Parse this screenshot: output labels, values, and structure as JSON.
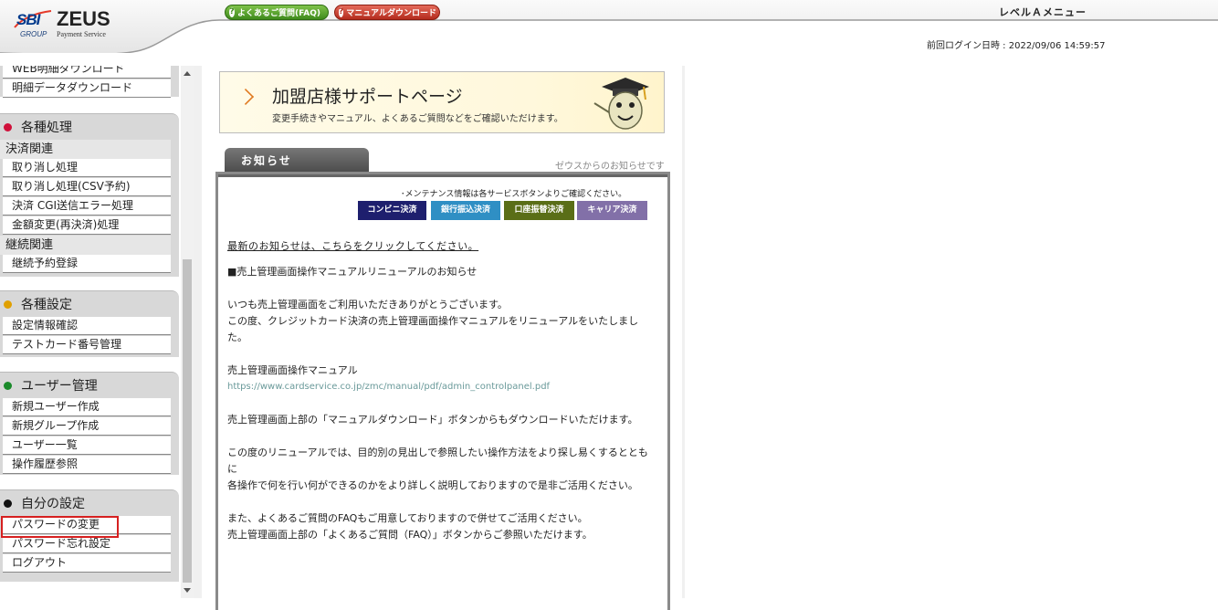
{
  "header": {
    "logo_sbi": "SBI",
    "logo_group": "GROUP",
    "logo_zeus": "ZEUS",
    "logo_payment": "Payment Service",
    "faq_button": "よくあるご質問(FAQ)",
    "manual_button": "マニュアルダウンロード",
    "level_title": "レベルＡメニュー",
    "last_login": "前回ログイン日時 : 2022/09/06 14:59:57"
  },
  "sidebar": {
    "top_items": [
      "WEB明細ダウンロード",
      "明細データダウンロード"
    ],
    "sections": [
      {
        "title": "各種処理",
        "dot_color": "#d0103a",
        "groups": [
          {
            "subhead": "決済関連",
            "items": [
              "取り消し処理",
              "取り消し処理(CSV予約)",
              "決済 CGI送信エラー処理",
              "金額変更(再決済)処理"
            ]
          },
          {
            "subhead": "継続関連",
            "items": [
              "継続予約登録"
            ]
          }
        ]
      },
      {
        "title": "各種設定",
        "dot_color": "#e0a000",
        "items": [
          "設定情報確認",
          "テストカード番号管理"
        ]
      },
      {
        "title": "ユーザー管理",
        "dot_color": "#1a8a2a",
        "items": [
          "新規ユーザー作成",
          "新規グループ作成",
          "ユーザー一覧",
          "操作履歴参照"
        ]
      },
      {
        "title": "自分の設定",
        "dot_color": "#111111",
        "items": [
          "パスワードの変更",
          "パスワード忘れ設定",
          "ログアウト"
        ]
      }
    ]
  },
  "banner": {
    "title": "加盟店様サポートページ",
    "subtitle": "変更手続きやマニュアル、よくあるご質問などをご確認いただけます。"
  },
  "notice": {
    "tab_label": "お知らせ",
    "hint": "ゼウスからのお知らせです",
    "maintenance": "･メンテナンス情報は各サービスボタンよりご確認ください。",
    "service_buttons": [
      "コンビニ決済",
      "銀行振込決済",
      "口座振替決済",
      "キャリア決済"
    ],
    "latest_link": "最新のお知らせは、こちらをクリックしてください。",
    "heading": "■売上管理画面操作マニュアルリニューアルのお知らせ",
    "para1": "いつも売上管理画面をご利用いただきありがとうございます。",
    "para2": "この度、クレジットカード決済の売上管理画面操作マニュアルをリニューアルをいたしました。",
    "manual_label": "売上管理画面操作マニュアル",
    "manual_url": "https://www.cardservice.co.jp/zmc/manual/pdf/admin_controlpanel.pdf",
    "para3": "売上管理画面上部の「マニュアルダウンロード」ボタンからもダウンロードいただけます。",
    "para4a": "この度のリニューアルでは、目的別の見出しで参照したい操作方法をより探し易くするとともに",
    "para4b": "各操作で何を行い何ができるのかをより詳しく説明しておりますので是非ご活用ください。",
    "para5a": "また、よくあるご質問のFAQもご用意しておりますので併せてご活用ください。",
    "para5b": "売上管理画面上部の「よくあるご質問（FAQ）」ボタンからご参照いただけます。"
  }
}
